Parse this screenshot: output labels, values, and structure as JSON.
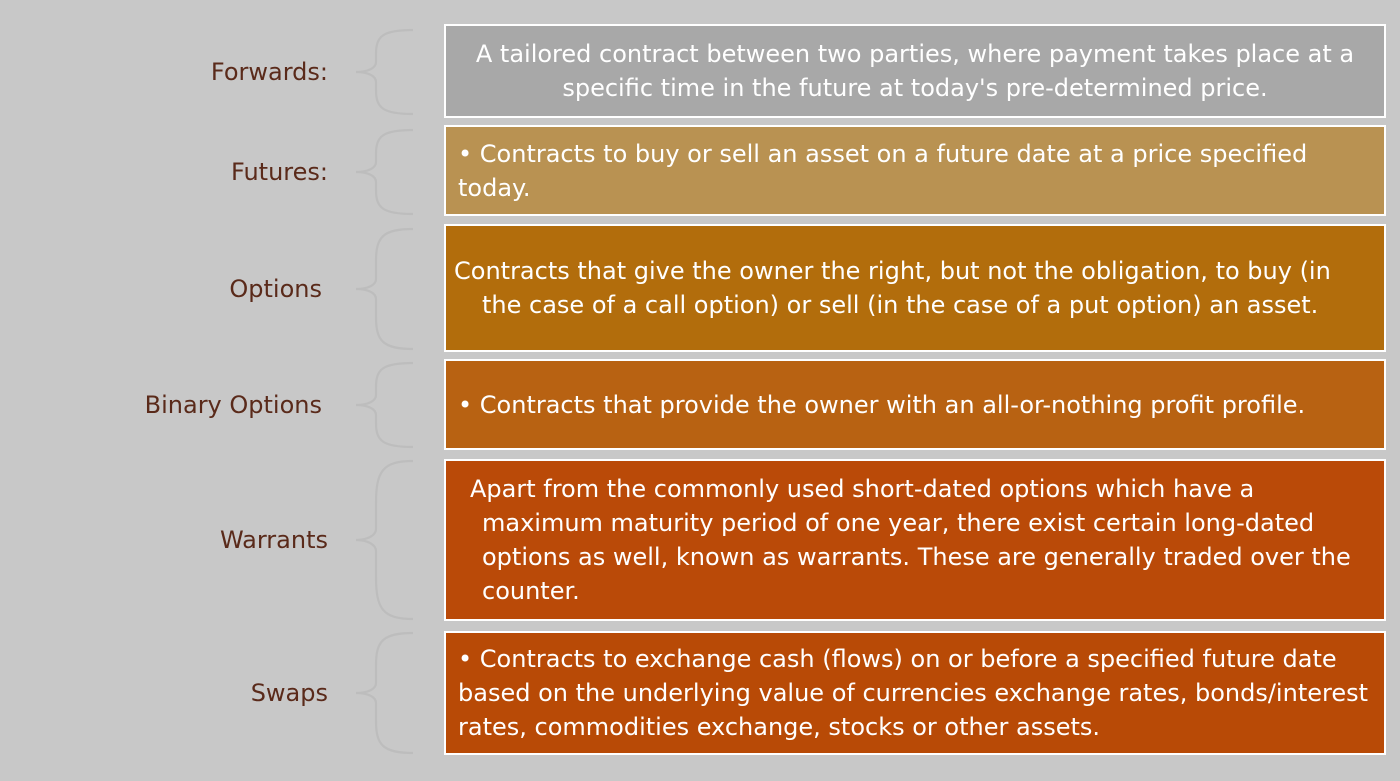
{
  "items": [
    {
      "label": "Forwards:",
      "text": "A tailored contract between two parties, where payment takes place at a specific time in the future at today's pre-determined price.",
      "style": "center",
      "color": "#a8a8a8",
      "bullet": ""
    },
    {
      "label": "Futures:",
      "text": "Contracts to buy or sell an asset on a future date at a price specified today.",
      "style": "bullet",
      "color": "#b99252",
      "bullet": "•"
    },
    {
      "label": "Options",
      "text": "Contracts that give the owner the right, but not the obligation, to buy (in the case of a call option) or sell (in the case of a put option) an asset.",
      "style": "hang",
      "color": "#b26d0c",
      "bullet": ""
    },
    {
      "label": "Binary Options",
      "text": "Contracts that provide the owner with an all-or-nothing profit profile.",
      "style": "bullet",
      "color": "#b86212",
      "bullet": "•"
    },
    {
      "label": "Warrants",
      "text": "Apart from the commonly used short-dated options which have a maximum maturity period of one year, there exist certain long-dated options as well, known as warrants. These are generally traded over the counter.",
      "style": "indent",
      "color": "#ba4a08",
      "bullet": ""
    },
    {
      "label": "Swaps",
      "text": "Contracts to exchange cash (flows) on or before a specified future date based on the underlying value of currencies exchange rates, bonds/interest rates, commodities exchange, stocks or other assets.",
      "style": "bullet",
      "color": "#b84a06",
      "bullet": "•"
    }
  ]
}
